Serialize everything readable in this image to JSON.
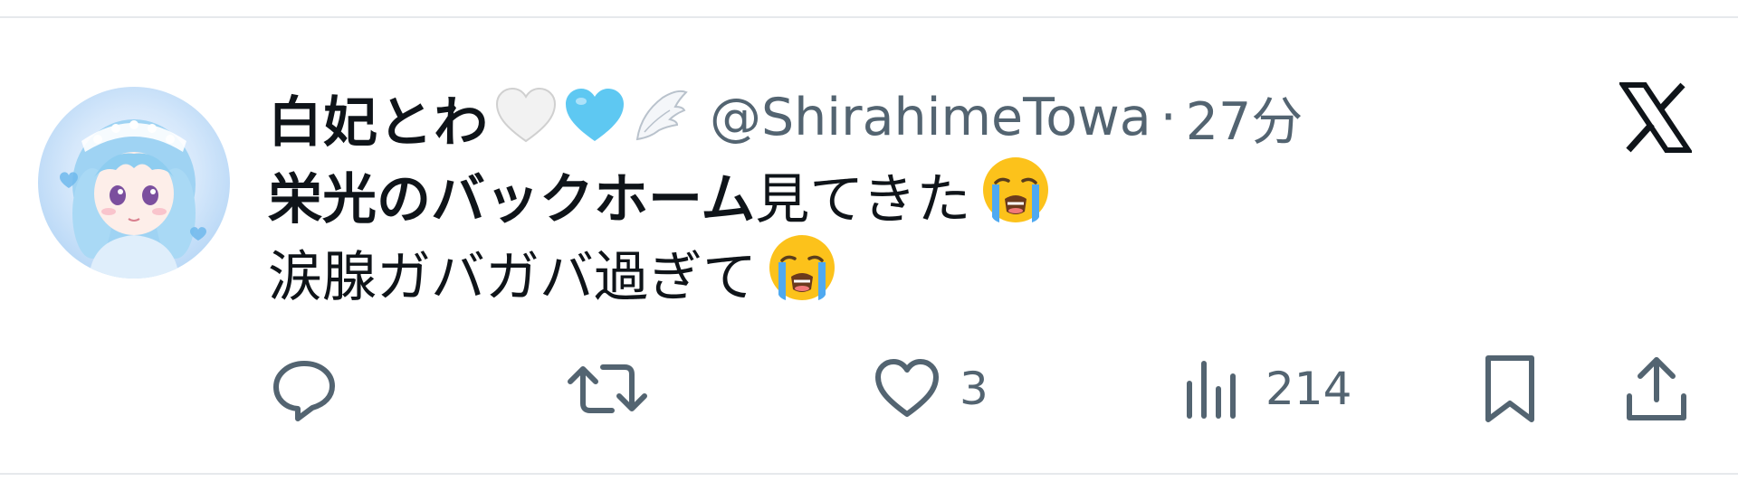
{
  "tweet": {
    "display_name": "白妃とわ",
    "handle": "@ShirahimeTowa",
    "separator": "·",
    "time": "27分",
    "badges": [
      "white-heart-icon",
      "light-blue-heart-icon",
      "angel-wing-icon"
    ],
    "body": {
      "line1_bold": "栄光のバックホーム",
      "line1_rest": "見てきた",
      "line2": "涙腺ガバガバ過ぎて",
      "emoji": "loudly-crying-face-icon"
    },
    "actions": {
      "reply_count": "",
      "retweet_count": "",
      "like_count": "3",
      "views_count": "214"
    }
  },
  "colors": {
    "text_primary": "#0f1419",
    "text_secondary": "#536471",
    "divider": "#e6e9ec",
    "heart_blue": "#5ec8f2"
  }
}
